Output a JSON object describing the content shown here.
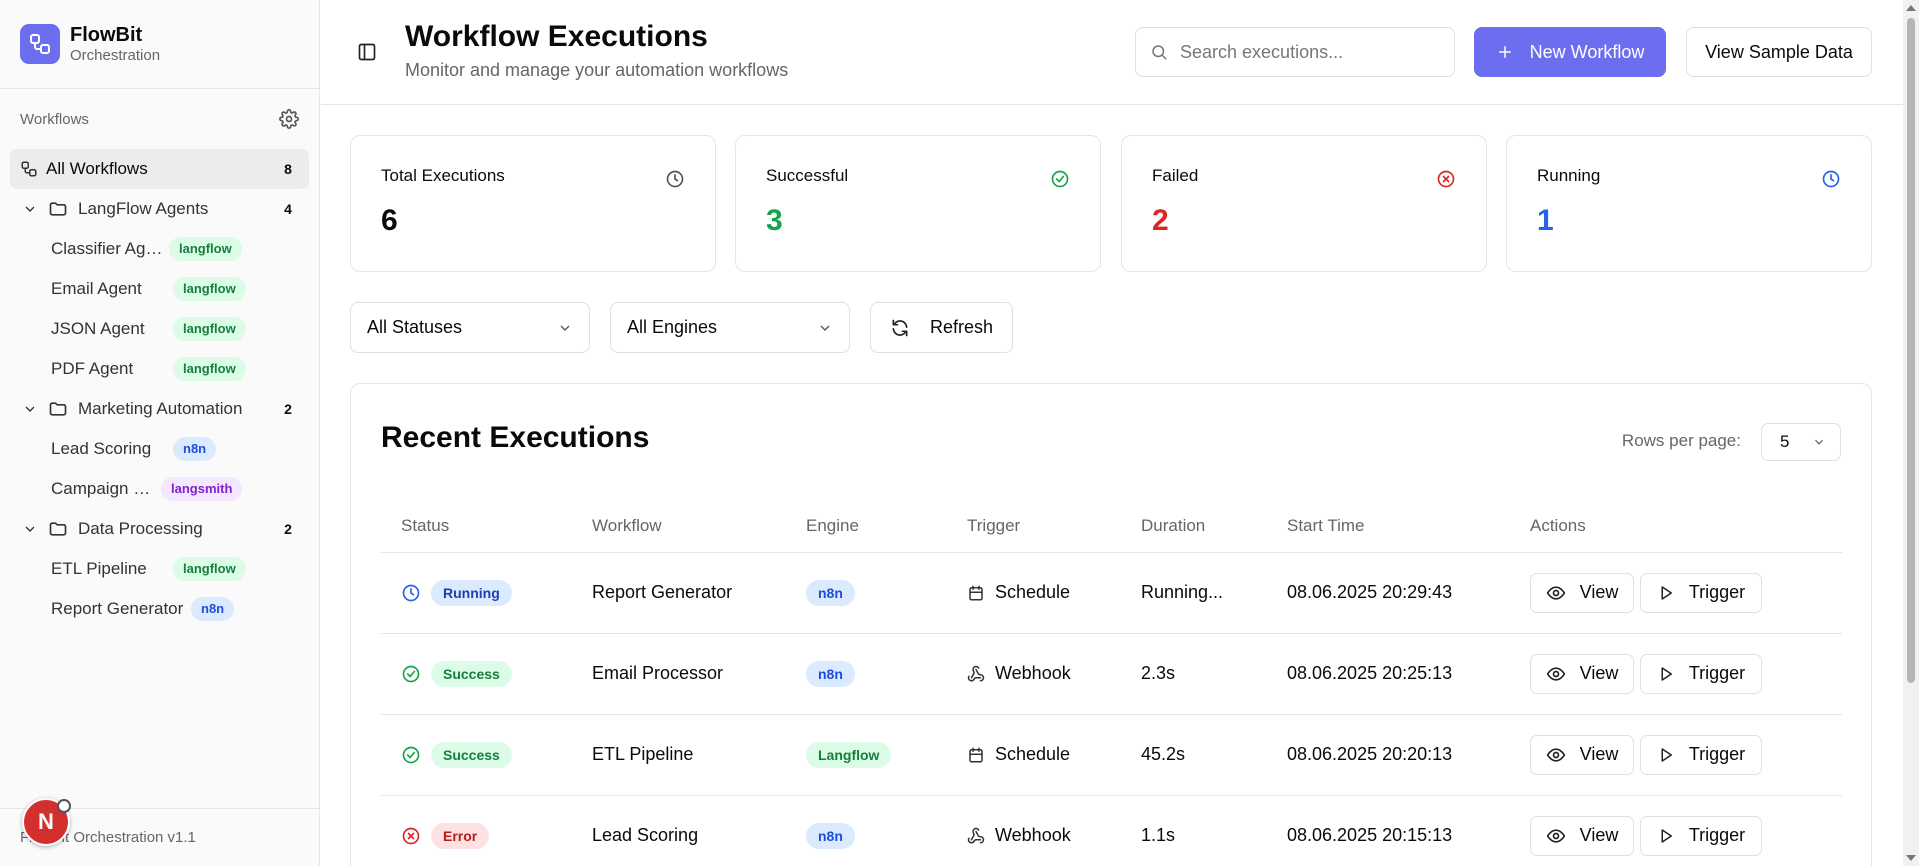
{
  "brand": {
    "name": "FlowBit",
    "subtitle": "Orchestration"
  },
  "sidebar": {
    "section_label": "Workflows",
    "all": {
      "label": "All Workflows",
      "count": "8"
    },
    "groups": [
      {
        "label": "LangFlow Agents",
        "count": "4",
        "items": [
          {
            "label": "Classifier Agent",
            "tag": "langflow"
          },
          {
            "label": "Email Agent",
            "tag": "langflow"
          },
          {
            "label": "JSON Agent",
            "tag": "langflow"
          },
          {
            "label": "PDF Agent",
            "tag": "langflow"
          }
        ]
      },
      {
        "label": "Marketing Automation",
        "count": "2",
        "items": [
          {
            "label": "Lead Scoring",
            "tag": "n8n"
          },
          {
            "label": "Campaign Manager",
            "tag": "langsmith"
          }
        ]
      },
      {
        "label": "Data Processing",
        "count": "2",
        "items": [
          {
            "label": "ETL Pipeline",
            "tag": "langflow"
          },
          {
            "label": "Report Generator",
            "tag": "n8n"
          }
        ]
      }
    ],
    "footer": "FlowBit Orchestration v1.1",
    "avatar_initial": "N"
  },
  "header": {
    "title": "Workflow Executions",
    "subtitle": "Monitor and manage your automation workflows",
    "search_placeholder": "Search executions...",
    "new_button": "New Workflow",
    "sample_button": "View Sample Data"
  },
  "stats": [
    {
      "label": "Total Executions",
      "value": "6",
      "color": "#0a0a0a",
      "icon": "clock-icon"
    },
    {
      "label": "Successful",
      "value": "3",
      "color": "#16a34a",
      "icon": "check-circle-icon"
    },
    {
      "label": "Failed",
      "value": "2",
      "color": "#dc2626",
      "icon": "x-circle-icon"
    },
    {
      "label": "Running",
      "value": "1",
      "color": "#2563eb",
      "icon": "clock-icon"
    }
  ],
  "filters": {
    "status": "All Statuses",
    "engine": "All Engines",
    "refresh": "Refresh"
  },
  "table": {
    "title": "Recent Executions",
    "rows_per_page_label": "Rows per page:",
    "rows_per_page": "5",
    "columns": [
      "Status",
      "Workflow",
      "Engine",
      "Trigger",
      "Duration",
      "Start Time",
      "Actions"
    ],
    "view_label": "View",
    "trigger_label": "Trigger",
    "rows": [
      {
        "status": "Running",
        "workflow": "Report Generator",
        "engine": "n8n",
        "trigger": "Schedule",
        "duration": "Running...",
        "start": "08.06.2025 20:29:43"
      },
      {
        "status": "Success",
        "workflow": "Email Processor",
        "engine": "n8n",
        "trigger": "Webhook",
        "duration": "2.3s",
        "start": "08.06.2025 20:25:13"
      },
      {
        "status": "Success",
        "workflow": "ETL Pipeline",
        "engine": "Langflow",
        "trigger": "Schedule",
        "duration": "45.2s",
        "start": "08.06.2025 20:20:13"
      },
      {
        "status": "Error",
        "workflow": "Lead Scoring",
        "engine": "n8n",
        "trigger": "Webhook",
        "duration": "1.1s",
        "start": "08.06.2025 20:15:13"
      }
    ]
  }
}
